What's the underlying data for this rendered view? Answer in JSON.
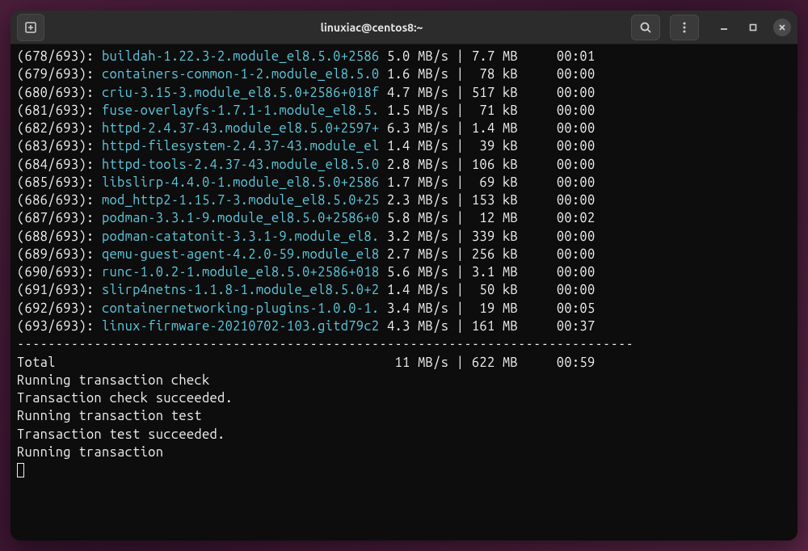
{
  "window": {
    "title": "linuxiac@centos8:~"
  },
  "packages": [
    {
      "idx": "(678/693)",
      "name": "buildah-1.22.3-2.module_el8.5.0+2586",
      "speed": "5.0 MB/s",
      "size": "7.7 MB",
      "time": "00:01"
    },
    {
      "idx": "(679/693)",
      "name": "containers-common-1-2.module_el8.5.0",
      "speed": "1.6 MB/s",
      "size": " 78 kB",
      "time": "00:00"
    },
    {
      "idx": "(680/693)",
      "name": "criu-3.15-3.module_el8.5.0+2586+018f",
      "speed": "4.7 MB/s",
      "size": "517 kB",
      "time": "00:00"
    },
    {
      "idx": "(681/693)",
      "name": "fuse-overlayfs-1.7.1-1.module_el8.5.",
      "speed": "1.5 MB/s",
      "size": " 71 kB",
      "time": "00:00"
    },
    {
      "idx": "(682/693)",
      "name": "httpd-2.4.37-43.module_el8.5.0+2597+",
      "speed": "6.3 MB/s",
      "size": "1.4 MB",
      "time": "00:00"
    },
    {
      "idx": "(683/693)",
      "name": "httpd-filesystem-2.4.37-43.module_el",
      "speed": "1.4 MB/s",
      "size": " 39 kB",
      "time": "00:00"
    },
    {
      "idx": "(684/693)",
      "name": "httpd-tools-2.4.37-43.module_el8.5.0",
      "speed": "2.8 MB/s",
      "size": "106 kB",
      "time": "00:00"
    },
    {
      "idx": "(685/693)",
      "name": "libslirp-4.4.0-1.module_el8.5.0+2586",
      "speed": "1.7 MB/s",
      "size": " 69 kB",
      "time": "00:00"
    },
    {
      "idx": "(686/693)",
      "name": "mod_http2-1.15.7-3.module_el8.5.0+25",
      "speed": "2.3 MB/s",
      "size": "153 kB",
      "time": "00:00"
    },
    {
      "idx": "(687/693)",
      "name": "podman-3.3.1-9.module_el8.5.0+2586+0",
      "speed": "5.8 MB/s",
      "size": " 12 MB",
      "time": "00:02"
    },
    {
      "idx": "(688/693)",
      "name": "podman-catatonit-3.3.1-9.module_el8.",
      "speed": "3.2 MB/s",
      "size": "339 kB",
      "time": "00:00"
    },
    {
      "idx": "(689/693)",
      "name": "qemu-guest-agent-4.2.0-59.module_el8",
      "speed": "2.7 MB/s",
      "size": "256 kB",
      "time": "00:00"
    },
    {
      "idx": "(690/693)",
      "name": "runc-1.0.2-1.module_el8.5.0+2586+018",
      "speed": "5.6 MB/s",
      "size": "3.1 MB",
      "time": "00:00"
    },
    {
      "idx": "(691/693)",
      "name": "slirp4netns-1.1.8-1.module_el8.5.0+2",
      "speed": "1.4 MB/s",
      "size": " 50 kB",
      "time": "00:00"
    },
    {
      "idx": "(692/693)",
      "name": "containernetworking-plugins-1.0.0-1.",
      "speed": "3.4 MB/s",
      "size": " 19 MB",
      "time": "00:05"
    },
    {
      "idx": "(693/693)",
      "name": "linux-firmware-20210702-103.gitd79c2",
      "speed": "4.3 MB/s",
      "size": "161 MB",
      "time": "00:37"
    }
  ],
  "divider": "--------------------------------------------------------------------------------",
  "total": {
    "label": "Total",
    "speed": " 11 MB/s",
    "size": "622 MB",
    "time": "00:59"
  },
  "status_lines": [
    "Running transaction check",
    "Transaction check succeeded.",
    "Running transaction test",
    "Transaction test succeeded.",
    "Running transaction"
  ]
}
